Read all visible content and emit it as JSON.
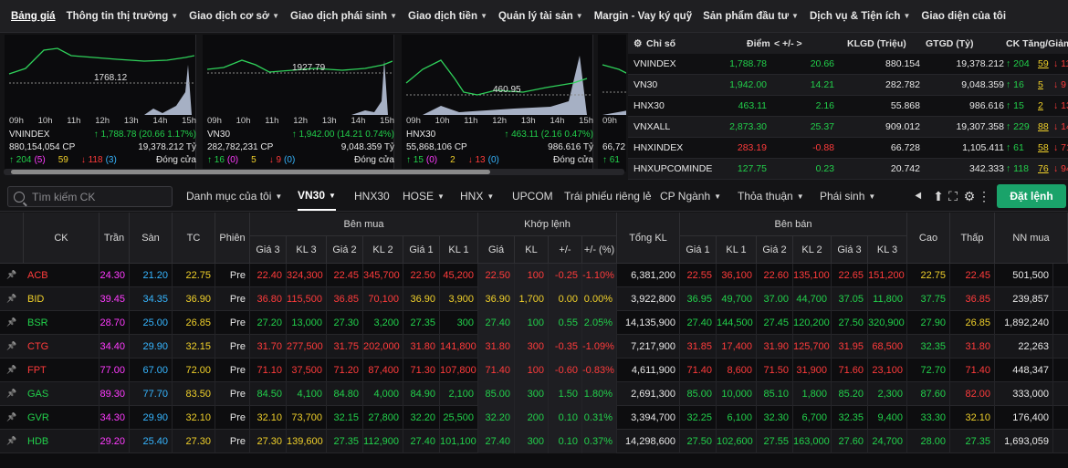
{
  "nav": {
    "items": [
      {
        "label": "Bảng giá",
        "caret": false
      },
      {
        "label": "Thông tin thị trường",
        "caret": true
      },
      {
        "label": "Giao dịch cơ sở",
        "caret": true
      },
      {
        "label": "Giao dịch phái sinh",
        "caret": true
      },
      {
        "label": "Giao dịch tiền",
        "caret": true
      },
      {
        "label": "Quản lý tài sản",
        "caret": true
      },
      {
        "label": "Margin - Vay ký quỹ",
        "caret": false
      },
      {
        "label": "Sản phẩm đầu tư",
        "caret": true
      },
      {
        "label": "Dịch vụ & Tiện ích",
        "caret": true
      },
      {
        "label": "Giao diện của tôi",
        "caret": false
      }
    ]
  },
  "mini_charts": [
    {
      "name": "VNINDEX",
      "ref_label": "1768.12",
      "hours": [
        "09h",
        "10h",
        "11h",
        "12h",
        "13h",
        "14h",
        "15h"
      ],
      "volume": "880,154,054 CP",
      "change": "↑ 1,788.78 (20.66 1.17%)",
      "value": "19,378.212 Tỷ",
      "up": "↑ 204",
      "up_ce": "(5)",
      "ref": "59",
      "down": "↓ 118",
      "down_fl": "(3)",
      "status": "Đóng cửa"
    },
    {
      "name": "VN30",
      "ref_label": "1927.79",
      "hours": [
        "09h",
        "10h",
        "11h",
        "12h",
        "13h",
        "14h",
        "15h"
      ],
      "volume": "282,782,231 CP",
      "change": "↑ 1,942.00 (14.21 0.74%)",
      "value": "9,048.359 Tỷ",
      "up": "↑ 16",
      "up_ce": "(0)",
      "ref": "5",
      "down": "↓ 9",
      "down_fl": "(0)",
      "status": "Đóng cửa"
    },
    {
      "name": "HNX30",
      "ref_label": "460.95",
      "hours": [
        "09h",
        "10h",
        "11h",
        "12h",
        "13h",
        "14h",
        "15h"
      ],
      "volume": "55,868,106 CP",
      "change": "↑ 463.11 (2.16 0.47%)",
      "value": "986.616 Tỷ",
      "up": "↑ 15",
      "up_ce": "(0)",
      "ref": "2",
      "down": "↓ 13",
      "down_fl": "(0)",
      "status": "Đóng cửa"
    },
    {
      "name": "",
      "ref_label": "",
      "hours": [
        "09h"
      ],
      "volume": "66,72",
      "change": "",
      "value": "",
      "up": "↑ 61",
      "up_ce": "",
      "ref": "",
      "down": "",
      "down_fl": "",
      "status": ""
    }
  ],
  "index_table": {
    "headers": {
      "name": "Chỉ số",
      "point": "Điểm",
      "change": "< +/- >",
      "klgd": "KLGD (Triệu)",
      "gtgd": "GTGD (Tỷ)",
      "ck": "CK Tăng/Giảm"
    },
    "rows": [
      {
        "name": "VNINDEX",
        "point": "1,788.78",
        "change": "20.66",
        "klgd": "880.154",
        "gtgd": "19,378.212",
        "up": "↑ 204",
        "ref": "59",
        "down": "↓ 118",
        "dir": "up"
      },
      {
        "name": "VN30",
        "point": "1,942.00",
        "change": "14.21",
        "klgd": "282.782",
        "gtgd": "9,048.359",
        "up": "↑ 16",
        "ref": "5",
        "down": "↓ 9",
        "dir": "up"
      },
      {
        "name": "HNX30",
        "point": "463.11",
        "change": "2.16",
        "klgd": "55.868",
        "gtgd": "986.616",
        "up": "↑ 15",
        "ref": "2",
        "down": "↓ 13",
        "dir": "up"
      },
      {
        "name": "VNXALL",
        "point": "2,873.30",
        "change": "25.37",
        "klgd": "909.012",
        "gtgd": "19,307.358",
        "up": "↑ 229",
        "ref": "88",
        "down": "↓ 142",
        "dir": "up"
      },
      {
        "name": "HNXINDEX",
        "point": "283.19",
        "change": "-0.88",
        "klgd": "66.728",
        "gtgd": "1,105.411",
        "up": "↑ 61",
        "ref": "58",
        "down": "↓ 71",
        "dir": "dn"
      },
      {
        "name": "HNXUPCOMINDE",
        "point": "127.75",
        "change": "0.23",
        "klgd": "20.742",
        "gtgd": "342.333",
        "up": "↑ 118",
        "ref": "76",
        "down": "↓ 94",
        "dir": "up"
      }
    ]
  },
  "toolbar": {
    "search_placeholder": "Tìm kiếm CK",
    "tabs": [
      {
        "label": "Danh mục của tôi",
        "caret": true
      },
      {
        "label": "VN30",
        "caret": true
      },
      {
        "label": "HNX30",
        "caret": false
      },
      {
        "label": "HOSE",
        "caret": true
      },
      {
        "label": "HNX",
        "caret": true
      },
      {
        "label": "UPCOM",
        "caret": false
      },
      {
        "label": "Trái phiếu riêng lẻ",
        "caret": false
      },
      {
        "label": "CP Ngành",
        "caret": true
      },
      {
        "label": "Thỏa thuận",
        "caret": true
      },
      {
        "label": "Phái sinh",
        "caret": true
      }
    ],
    "order_button": "Đặt lệnh"
  },
  "board": {
    "headers": {
      "ck": "CK",
      "tran": "Trần",
      "san": "Sàn",
      "tc": "TC",
      "phien": "Phiên",
      "ben_mua": "Bên mua",
      "khop_lenh": "Khớp lệnh",
      "tong_kl": "Tổng KL",
      "ben_ban": "Bên bán",
      "cao": "Cao",
      "thap": "Thấp",
      "nn_mua": "NN mua",
      "gia3": "Giá 3",
      "kl3": "KL 3",
      "gia2": "Giá 2",
      "kl2": "KL 2",
      "gia1": "Giá 1",
      "kl1": "KL 1",
      "gia": "Giá",
      "kl": "KL",
      "pm": "+/-",
      "pct": "+/- (%)"
    },
    "rows": [
      {
        "ck": "ACB",
        "tran": "24.30",
        "san": "21.20",
        "tc": "22.75",
        "phien": "Pre",
        "b3": "22.40",
        "bk3": "324,300",
        "b2": "22.45",
        "bk2": "345,700",
        "b1": "22.50",
        "bk1": "45,200",
        "gia": "22.50",
        "kl": "100",
        "pm": "-0.25",
        "pct": "-1.10%",
        "tong": "6,381,200",
        "s1": "22.55",
        "sk1": "36,100",
        "s2": "22.60",
        "sk2": "135,100",
        "s3": "22.65",
        "sk3": "151,200",
        "cao": "22.75",
        "thap": "22.45",
        "nn": "501,500",
        "c": {
          "ck": "dn",
          "b3": "dn",
          "b2": "dn",
          "b1": "dn",
          "gia": "dn",
          "s1": "dn",
          "s2": "dn",
          "s3": "dn",
          "cao": "rf",
          "thap": "dn"
        }
      },
      {
        "ck": "BID",
        "tran": "39.45",
        "san": "34.35",
        "tc": "36.90",
        "phien": "Pre",
        "b3": "36.80",
        "bk3": "115,500",
        "b2": "36.85",
        "bk2": "70,100",
        "b1": "36.90",
        "bk1": "3,900",
        "gia": "36.90",
        "kl": "1,700",
        "pm": "0.00",
        "pct": "0.00%",
        "tong": "3,922,800",
        "s1": "36.95",
        "sk1": "49,700",
        "s2": "37.00",
        "sk2": "44,700",
        "s3": "37.05",
        "sk3": "11,800",
        "cao": "37.75",
        "thap": "36.85",
        "nn": "239,857",
        "c": {
          "ck": "rf",
          "b3": "dn",
          "b2": "dn",
          "b1": "rf",
          "gia": "rf",
          "s1": "up",
          "s2": "up",
          "s3": "up",
          "cao": "up",
          "thap": "dn"
        }
      },
      {
        "ck": "BSR",
        "tran": "28.70",
        "san": "25.00",
        "tc": "26.85",
        "phien": "Pre",
        "b3": "27.20",
        "bk3": "13,000",
        "b2": "27.30",
        "bk2": "3,200",
        "b1": "27.35",
        "bk1": "300",
        "gia": "27.40",
        "kl": "100",
        "pm": "0.55",
        "pct": "2.05%",
        "tong": "14,135,900",
        "s1": "27.40",
        "sk1": "144,500",
        "s2": "27.45",
        "sk2": "120,200",
        "s3": "27.50",
        "sk3": "320,900",
        "cao": "27.90",
        "thap": "26.85",
        "nn": "1,892,240",
        "c": {
          "ck": "up",
          "b3": "up",
          "b2": "up",
          "b1": "up",
          "gia": "up",
          "s1": "up",
          "s2": "up",
          "s3": "up",
          "cao": "up",
          "thap": "rf"
        }
      },
      {
        "ck": "CTG",
        "tran": "34.40",
        "san": "29.90",
        "tc": "32.15",
        "phien": "Pre",
        "b3": "31.70",
        "bk3": "277,500",
        "b2": "31.75",
        "bk2": "202,000",
        "b1": "31.80",
        "bk1": "141,800",
        "gia": "31.80",
        "kl": "300",
        "pm": "-0.35",
        "pct": "-1.09%",
        "tong": "7,217,900",
        "s1": "31.85",
        "sk1": "17,400",
        "s2": "31.90",
        "sk2": "125,700",
        "s3": "31.95",
        "sk3": "68,500",
        "cao": "32.35",
        "thap": "31.80",
        "nn": "22,263",
        "c": {
          "ck": "dn",
          "b3": "dn",
          "b2": "dn",
          "b1": "dn",
          "gia": "dn",
          "s1": "dn",
          "s2": "dn",
          "s3": "dn",
          "cao": "up",
          "thap": "dn"
        }
      },
      {
        "ck": "FPT",
        "tran": "77.00",
        "san": "67.00",
        "tc": "72.00",
        "phien": "Pre",
        "b3": "71.10",
        "bk3": "37,500",
        "b2": "71.20",
        "bk2": "87,400",
        "b1": "71.30",
        "bk1": "107,800",
        "gia": "71.40",
        "kl": "100",
        "pm": "-0.60",
        "pct": "-0.83%",
        "tong": "4,611,900",
        "s1": "71.40",
        "sk1": "8,600",
        "s2": "71.50",
        "sk2": "31,900",
        "s3": "71.60",
        "sk3": "23,100",
        "cao": "72.70",
        "thap": "71.40",
        "nn": "448,347",
        "c": {
          "ck": "dn",
          "b3": "dn",
          "b2": "dn",
          "b1": "dn",
          "gia": "dn",
          "s1": "dn",
          "s2": "dn",
          "s3": "dn",
          "cao": "up",
          "thap": "dn"
        }
      },
      {
        "ck": "GAS",
        "tran": "89.30",
        "san": "77.70",
        "tc": "83.50",
        "phien": "Pre",
        "b3": "84.50",
        "bk3": "4,100",
        "b2": "84.80",
        "bk2": "4,000",
        "b1": "84.90",
        "bk1": "2,100",
        "gia": "85.00",
        "kl": "300",
        "pm": "1.50",
        "pct": "1.80%",
        "tong": "2,691,300",
        "s1": "85.00",
        "sk1": "10,000",
        "s2": "85.10",
        "sk2": "1,800",
        "s3": "85.20",
        "sk3": "2,300",
        "cao": "87.60",
        "thap": "82.00",
        "nn": "333,000",
        "c": {
          "ck": "up",
          "b3": "up",
          "b2": "up",
          "b1": "up",
          "gia": "up",
          "s1": "up",
          "s2": "up",
          "s3": "up",
          "cao": "up",
          "thap": "dn"
        }
      },
      {
        "ck": "GVR",
        "tran": "34.30",
        "san": "29.90",
        "tc": "32.10",
        "phien": "Pre",
        "b3": "32.10",
        "bk3": "73,700",
        "b2": "32.15",
        "bk2": "27,800",
        "b1": "32.20",
        "bk1": "25,500",
        "gia": "32.20",
        "kl": "200",
        "pm": "0.10",
        "pct": "0.31%",
        "tong": "3,394,700",
        "s1": "32.25",
        "sk1": "6,100",
        "s2": "32.30",
        "sk2": "6,700",
        "s3": "32.35",
        "sk3": "9,400",
        "cao": "33.30",
        "thap": "32.10",
        "nn": "176,400",
        "c": {
          "ck": "up",
          "b3": "rf",
          "b2": "up",
          "b1": "up",
          "gia": "up",
          "s1": "up",
          "s2": "up",
          "s3": "up",
          "cao": "up",
          "thap": "rf"
        }
      },
      {
        "ck": "HDB",
        "tran": "29.20",
        "san": "25.40",
        "tc": "27.30",
        "phien": "Pre",
        "b3": "27.30",
        "bk3": "139,600",
        "b2": "27.35",
        "bk2": "112,900",
        "b1": "27.40",
        "bk1": "101,100",
        "gia": "27.40",
        "kl": "300",
        "pm": "0.10",
        "pct": "0.37%",
        "tong": "14,298,600",
        "s1": "27.50",
        "sk1": "102,600",
        "s2": "27.55",
        "sk2": "163,000",
        "s3": "27.60",
        "sk3": "24,700",
        "cao": "28.00",
        "thap": "27.35",
        "nn": "1,693,059",
        "c": {
          "ck": "up",
          "b3": "rf",
          "b2": "up",
          "b1": "up",
          "gia": "up",
          "s1": "up",
          "s2": "up",
          "s3": "up",
          "cao": "up",
          "thap": "up"
        }
      }
    ]
  },
  "colors": {
    "up": "#22d04b",
    "down": "#ff3b3b",
    "ref": "#f0d02a",
    "ceil": "#ff3bff",
    "floor": "#36b5ff",
    "accent": "#1aa36a"
  }
}
